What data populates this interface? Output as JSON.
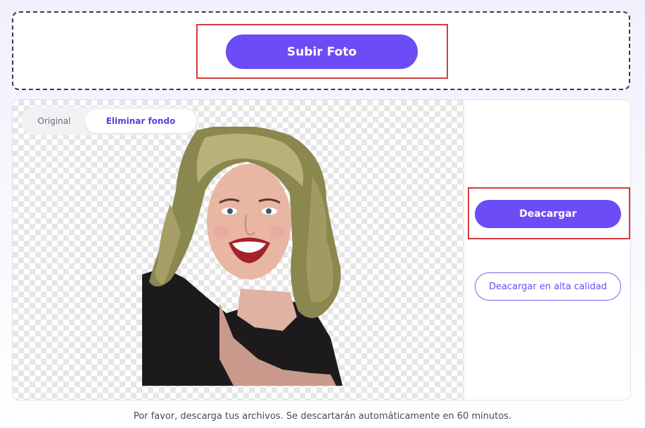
{
  "upload": {
    "button_label": "Subir Foto"
  },
  "view_toggle": {
    "original_label": "Original",
    "remove_bg_label": "Eliminar fondo",
    "active": "Eliminar fondo"
  },
  "preview": {
    "image_icon": "portrait-image"
  },
  "actions": {
    "download_label": "Deacargar",
    "download_hq_label": "Deacargar en alta calidad"
  },
  "footer": {
    "note": "Por favor, descarga tus archivos. Se descartarán automáticamente en 60 minutos."
  },
  "colors": {
    "accent": "#6b4cf6",
    "highlight": "#d63b3b"
  }
}
